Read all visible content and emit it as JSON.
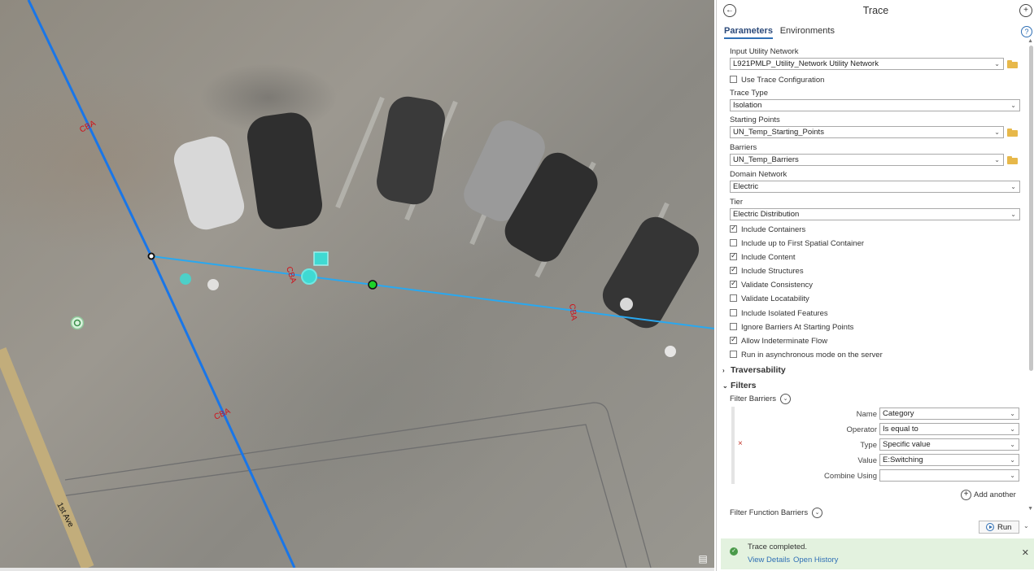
{
  "map": {
    "line_labels": [
      "CBA",
      "CBA",
      "CBA",
      "CBA"
    ],
    "road_label": "1st Ave",
    "colors": {
      "line_primary": "#1976e8",
      "line_secondary": "#29a8f0",
      "label": "#d0101a",
      "point_cyan": "#3fd9d2",
      "point_green": "#1ed22a"
    },
    "tool_icon": "map-tool-icon"
  },
  "pane": {
    "title": "Trace",
    "back_icon": "back-arrow-icon",
    "add_icon": "add-icon",
    "help_icon": "help-icon",
    "tabs": [
      {
        "label": "Parameters",
        "active": true
      },
      {
        "label": "Environments",
        "active": false
      }
    ]
  },
  "params": {
    "input_network_label": "Input Utility Network",
    "input_network_value": "L921PMLP_Utility_Network Utility Network",
    "use_trace_config": "Use Trace Configuration",
    "trace_type_label": "Trace Type",
    "trace_type_value": "Isolation",
    "starting_points_label": "Starting Points",
    "starting_points_value": "UN_Temp_Starting_Points",
    "barriers_label": "Barriers",
    "barriers_value": "UN_Temp_Barriers",
    "domain_label": "Domain Network",
    "domain_value": "Electric",
    "tier_label": "Tier",
    "tier_value": "Electric Distribution",
    "options": [
      {
        "label": "Include Containers",
        "checked": true
      },
      {
        "label": "Include up to First Spatial Container",
        "checked": false
      },
      {
        "label": "Include Content",
        "checked": true
      },
      {
        "label": "Include Structures",
        "checked": true
      },
      {
        "label": "Validate Consistency",
        "checked": true
      },
      {
        "label": "Validate Locatability",
        "checked": false
      },
      {
        "label": "Include Isolated Features",
        "checked": false
      },
      {
        "label": "Ignore Barriers At Starting Points",
        "checked": false
      },
      {
        "label": "Allow Indeterminate Flow",
        "checked": true
      },
      {
        "label": "Run in asynchronous mode on the server",
        "checked": false
      }
    ]
  },
  "traversability": {
    "label": "Traversability",
    "expanded": false
  },
  "filters": {
    "label": "Filters",
    "expanded": true,
    "filter_barriers_label": "Filter Barriers",
    "name_label": "Name",
    "name_value": "Category",
    "operator_label": "Operator",
    "operator_value": "Is equal to",
    "type_label": "Type",
    "type_value": "Specific value",
    "value_label": "Value",
    "value_value": "E:Switching",
    "combine_label": "Combine Using",
    "combine_value": "",
    "add_another": "Add another",
    "filter_function_label": "Filter Function Barriers"
  },
  "run": {
    "label": "Run"
  },
  "status": {
    "message": "Trace completed.",
    "view_details": "View Details",
    "open_history": "Open History"
  }
}
